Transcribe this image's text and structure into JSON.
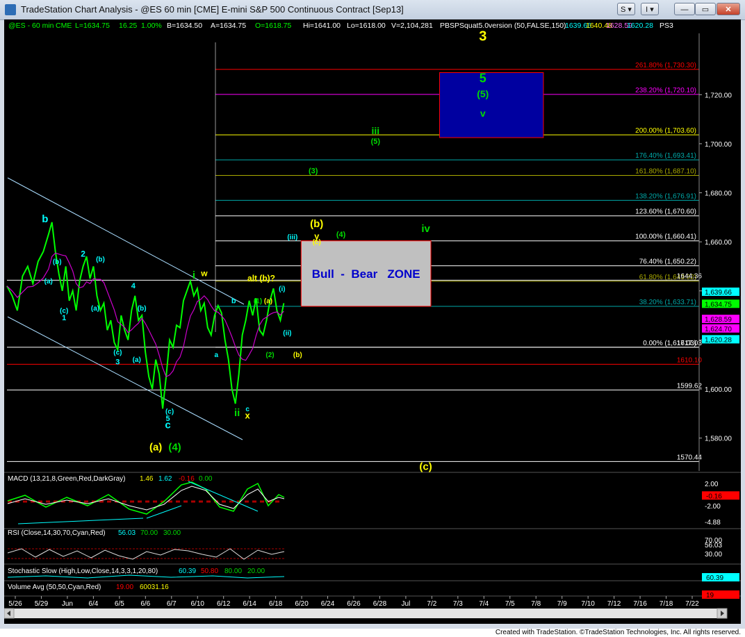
{
  "window": {
    "title": "TradeStation Chart Analysis - @ES 60 min [CME] E-mini S&P 500 Continuous Contract [Sep13]",
    "buttons": {
      "s": "S",
      "i": "I",
      "minimize": "—",
      "maximize": "▭",
      "close": "✕"
    }
  },
  "header": {
    "symbol": "@ES - 60 min",
    "exchange": "CME",
    "last": "L=1634.75",
    "change": "16.25",
    "pct": "1.00%",
    "bid": "B=1634.50",
    "ask": "A=1634.75",
    "open": "O=1618.75",
    "high": "Hi=1641.00",
    "low": "Lo=1618.00",
    "volume": "V=2,104,281",
    "indicator": "PBSPSquat5.0version (50,FALSE,150)",
    "ind_values": [
      "1639.66",
      "1640.48",
      "1628.59",
      "1620.28"
    ],
    "ind_tail": "PS3"
  },
  "colors": {
    "bg": "#000000",
    "price": "#00ff00",
    "cyan": "#00ffff",
    "yellow": "#ffff00",
    "green": "#00dd00",
    "red": "#ff0000",
    "magenta": "#dd00dd",
    "white": "#ffffff",
    "zone_bull": "#c0c0c0",
    "zone_top": "#0000a0"
  },
  "chart_data": {
    "type": "line",
    "title": "@ES 60 min [CME] E-mini S&P 500 Continuous Contract [Sep13]",
    "ylim": [
      1568,
      1745
    ],
    "y_ticks": [
      1580,
      1600,
      1620,
      1640,
      1660,
      1680,
      1700,
      1720
    ],
    "x_ticks": [
      "5/26",
      "5/29",
      "Jun",
      "6/4",
      "6/5",
      "6/6",
      "6/7",
      "6/10",
      "6/12",
      "6/14",
      "6/18",
      "6/20",
      "6/24",
      "6/26",
      "6/28",
      "Jul",
      "7/2",
      "7/3",
      "7/4",
      "7/5",
      "7/8",
      "7/9",
      "7/10",
      "7/12",
      "7/16",
      "7/18",
      "7/22"
    ],
    "price_series": [
      [
        0,
        1642
      ],
      [
        0.3,
        1638
      ],
      [
        0.6,
        1632
      ],
      [
        0.9,
        1646
      ],
      [
        1.2,
        1650
      ],
      [
        1.5,
        1643
      ],
      [
        1.8,
        1652
      ],
      [
        2.1,
        1656
      ],
      [
        2.4,
        1663
      ],
      [
        2.6,
        1668
      ],
      [
        2.8,
        1656
      ],
      [
        3.0,
        1647
      ],
      [
        3.2,
        1640
      ],
      [
        3.4,
        1650
      ],
      [
        3.6,
        1636
      ],
      [
        3.8,
        1640
      ],
      [
        4.0,
        1632
      ],
      [
        4.2,
        1644
      ],
      [
        4.4,
        1650
      ],
      [
        4.6,
        1654
      ],
      [
        4.8,
        1645
      ],
      [
        5.0,
        1650
      ],
      [
        5.2,
        1638
      ],
      [
        5.4,
        1632
      ],
      [
        5.6,
        1635
      ],
      [
        5.8,
        1624
      ],
      [
        6.0,
        1628
      ],
      [
        6.2,
        1619
      ],
      [
        6.4,
        1616
      ],
      [
        6.6,
        1630
      ],
      [
        6.8,
        1624
      ],
      [
        7.0,
        1620
      ],
      [
        7.2,
        1632
      ],
      [
        7.4,
        1638
      ],
      [
        7.6,
        1628
      ],
      [
        7.8,
        1630
      ],
      [
        8.0,
        1615
      ],
      [
        8.2,
        1605
      ],
      [
        8.4,
        1600
      ],
      [
        8.6,
        1612
      ],
      [
        8.8,
        1606
      ],
      [
        9.0,
        1592
      ],
      [
        9.2,
        1605
      ],
      [
        9.4,
        1620
      ],
      [
        9.6,
        1617
      ],
      [
        9.8,
        1626
      ],
      [
        10.0,
        1625
      ],
      [
        10.2,
        1636
      ],
      [
        10.4,
        1640
      ],
      [
        10.6,
        1644
      ],
      [
        10.8,
        1638
      ],
      [
        11.0,
        1641
      ],
      [
        11.2,
        1632
      ],
      [
        11.4,
        1635
      ],
      [
        11.6,
        1625
      ],
      [
        11.8,
        1622
      ],
      [
        12.0,
        1630
      ],
      [
        12.2,
        1634
      ],
      [
        12.4,
        1631
      ],
      [
        12.6,
        1620
      ],
      [
        12.8,
        1612
      ],
      [
        13.0,
        1600
      ],
      [
        13.2,
        1594
      ],
      [
        13.4,
        1606
      ],
      [
        13.6,
        1622
      ],
      [
        13.8,
        1628
      ],
      [
        14.0,
        1636
      ],
      [
        14.2,
        1630
      ],
      [
        14.4,
        1637
      ],
      [
        14.6,
        1624
      ],
      [
        14.8,
        1622
      ],
      [
        15.0,
        1628
      ],
      [
        15.2,
        1636
      ],
      [
        15.4,
        1641
      ],
      [
        15.6,
        1632
      ],
      [
        15.8,
        1628
      ],
      [
        16.0,
        1635
      ]
    ],
    "fib_levels": [
      {
        "pct": "261.80%",
        "value": 1730.3,
        "label": "261.80% (1,730.30)",
        "color": "#ff0000"
      },
      {
        "pct": "238.20%",
        "value": 1720.1,
        "label": "238.20% (1,720.10)",
        "color": "#ff00ff"
      },
      {
        "pct": "200.00%",
        "value": 1703.6,
        "label": "200.00% (1,703.60)",
        "color": "#ffff00"
      },
      {
        "pct": "176.40%",
        "value": 1693.41,
        "label": "176.40% (1,693.41)",
        "color": "#00aaaa"
      },
      {
        "pct": "161.80%",
        "value": 1687.1,
        "label": "161.80% (1,687.10)",
        "color": "#aaaa00"
      },
      {
        "pct": "138.20%",
        "value": 1676.91,
        "label": "138.20% (1,676.91)",
        "color": "#00aaaa"
      },
      {
        "pct": "123.60%",
        "value": 1670.6,
        "label": "123.60% (1,670.60)",
        "color": "#ffffff"
      },
      {
        "pct": "100.00%",
        "value": 1660.41,
        "label": "100.00% (1,660.41)",
        "color": "#ffffff"
      },
      {
        "pct": "76.40%",
        "value": 1650.22,
        "label": "76.40% (1,650.22)",
        "color": "#ffffff"
      },
      {
        "pct": "61.80%",
        "value": 1643.92,
        "label": "61.80% (1,643.92)",
        "color": "#aaaa00"
      },
      {
        "pct": "38.20%",
        "value": 1633.71,
        "label": "38.20% (1,633.71)",
        "color": "#00aaaa"
      },
      {
        "pct": "0.00%",
        "value": 1617.03,
        "label": "0.00% (1,617.03)",
        "color": "#ffffff"
      }
    ],
    "levels": [
      {
        "value": 1644.36,
        "label": "1644.36",
        "color": "#ffffff"
      },
      {
        "value": 1617.03,
        "label": "1617.03",
        "color": "#ffffff"
      },
      {
        "value": 1610.1,
        "label": "1610.10",
        "color": "#ff0000"
      },
      {
        "value": 1599.62,
        "label": "1599.62",
        "color": "#ffffff"
      },
      {
        "value": 1570.44,
        "label": "1570.44",
        "color": "#ffffff"
      }
    ],
    "axis_badges": [
      {
        "value": 1639.66,
        "label": "1,639.66",
        "color": "#00ffff"
      },
      {
        "value": 1634.75,
        "label": "1,634.75",
        "color": "#00ff00"
      },
      {
        "value": 1628.59,
        "label": "1,628.59",
        "color": "#ff00ff"
      },
      {
        "value": 1624.7,
        "label": "1,624.70",
        "color": "#ff00ff"
      },
      {
        "value": 1620.28,
        "label": "1,620.28",
        "color": "#00ffff"
      }
    ],
    "zones": [
      {
        "name": "Bull - Bear ZONE",
        "label": "Bull  -  Bear   ZONE",
        "top": 1660.41,
        "bottom": 1633.71,
        "x_start": 17.0,
        "x_end": 24.5,
        "fill": "#c0c0c0",
        "text_color": "#0000cc"
      },
      {
        "name": "target box",
        "label": "",
        "top": 1729.0,
        "bottom": 1702.5,
        "x_start": 25.0,
        "x_end": 31.0,
        "fill": "#0000a0",
        "text_color": ""
      }
    ],
    "wave_labels": [
      {
        "text": "3",
        "x": 27.5,
        "y": 1742,
        "color": "#ffff00",
        "size": 20
      },
      {
        "text": "5",
        "x": 27.5,
        "y": 1725,
        "color": "#00dd00",
        "size": 18
      },
      {
        "text": "(5)",
        "x": 27.5,
        "y": 1719,
        "color": "#00dd00",
        "size": 14
      },
      {
        "text": "v",
        "x": 27.5,
        "y": 1711,
        "color": "#00dd00",
        "size": 14
      },
      {
        "text": "iii",
        "x": 21.3,
        "y": 1704,
        "color": "#00dd00",
        "size": 14
      },
      {
        "text": "(5)",
        "x": 21.3,
        "y": 1700,
        "color": "#00dd00",
        "size": 11
      },
      {
        "text": "(3)",
        "x": 17.7,
        "y": 1688,
        "color": "#00dd00",
        "size": 11
      },
      {
        "text": "(b)",
        "x": 17.9,
        "y": 1666,
        "color": "#ffff00",
        "size": 15
      },
      {
        "text": "y",
        "x": 17.9,
        "y": 1661,
        "color": "#ffff00",
        "size": 13
      },
      {
        "text": "(c)",
        "x": 17.9,
        "y": 1659,
        "color": "#ffff00",
        "size": 10
      },
      {
        "text": "(4)",
        "x": 19.3,
        "y": 1662,
        "color": "#00dd00",
        "size": 11
      },
      {
        "text": "iv",
        "x": 24.2,
        "y": 1664,
        "color": "#00dd00",
        "size": 15
      },
      {
        "text": "(iii)",
        "x": 16.5,
        "y": 1661,
        "color": "#00ffff",
        "size": 10
      },
      {
        "text": "alt (b)?",
        "x": 14.7,
        "y": 1644,
        "color": "#ffff00",
        "size": 12
      },
      {
        "text": "(i)",
        "x": 15.9,
        "y": 1640,
        "color": "#00ffff",
        "size": 10
      },
      {
        "text": "(1)",
        "x": 14.5,
        "y": 1635,
        "color": "#00dd00",
        "size": 10
      },
      {
        "text": "(a)",
        "x": 15.1,
        "y": 1635,
        "color": "#ffff00",
        "size": 10
      },
      {
        "text": "(ii)",
        "x": 16.2,
        "y": 1622,
        "color": "#00ffff",
        "size": 10
      },
      {
        "text": "(2)",
        "x": 15.2,
        "y": 1613,
        "color": "#00dd00",
        "size": 10
      },
      {
        "text": "(b)",
        "x": 16.8,
        "y": 1613,
        "color": "#ffff00",
        "size": 10
      },
      {
        "text": "b",
        "x": 2.2,
        "y": 1668,
        "color": "#00ffff",
        "size": 15
      },
      {
        "text": "(b)",
        "x": 2.9,
        "y": 1651,
        "color": "#00ffff",
        "size": 10
      },
      {
        "text": "(a)",
        "x": 2.4,
        "y": 1643,
        "color": "#00ffff",
        "size": 10
      },
      {
        "text": "2",
        "x": 4.4,
        "y": 1654,
        "color": "#00ffff",
        "size": 12
      },
      {
        "text": "(b)",
        "x": 5.4,
        "y": 1652,
        "color": "#00ffff",
        "size": 10
      },
      {
        "text": "(c)",
        "x": 3.3,
        "y": 1631,
        "color": "#00ffff",
        "size": 10
      },
      {
        "text": "1",
        "x": 3.3,
        "y": 1628,
        "color": "#00ffff",
        "size": 11
      },
      {
        "text": "4",
        "x": 7.3,
        "y": 1641,
        "color": "#00ffff",
        "size": 11
      },
      {
        "text": "(a)",
        "x": 5.1,
        "y": 1632,
        "color": "#00ffff",
        "size": 10
      },
      {
        "text": "(b)",
        "x": 7.8,
        "y": 1632,
        "color": "#00ffff",
        "size": 10
      },
      {
        "text": "(c)",
        "x": 6.4,
        "y": 1614,
        "color": "#00ffff",
        "size": 10
      },
      {
        "text": "3",
        "x": 6.4,
        "y": 1610,
        "color": "#00ffff",
        "size": 11
      },
      {
        "text": "(a)",
        "x": 7.5,
        "y": 1611,
        "color": "#00ffff",
        "size": 10
      },
      {
        "text": "i",
        "x": 10.8,
        "y": 1645,
        "color": "#00dd00",
        "size": 15
      },
      {
        "text": "w",
        "x": 11.4,
        "y": 1646,
        "color": "#ffff00",
        "size": 12
      },
      {
        "text": "b",
        "x": 13.1,
        "y": 1635,
        "color": "#00ffff",
        "size": 11
      },
      {
        "text": "a",
        "x": 12.1,
        "y": 1613,
        "color": "#00ffff",
        "size": 10
      },
      {
        "text": "ii",
        "x": 13.3,
        "y": 1589,
        "color": "#00dd00",
        "size": 15
      },
      {
        "text": "c",
        "x": 13.9,
        "y": 1591,
        "color": "#00ffff",
        "size": 10
      },
      {
        "text": "x",
        "x": 13.9,
        "y": 1588,
        "color": "#ffff00",
        "size": 13
      },
      {
        "text": "(c)",
        "x": 9.4,
        "y": 1590,
        "color": "#00ffff",
        "size": 10
      },
      {
        "text": "5",
        "x": 9.3,
        "y": 1587,
        "color": "#00ffff",
        "size": 11
      },
      {
        "text": "c",
        "x": 9.3,
        "y": 1584,
        "color": "#00ffff",
        "size": 15
      },
      {
        "text": "(a)",
        "x": 8.6,
        "y": 1575,
        "color": "#ffff00",
        "size": 15
      },
      {
        "text": "(4)",
        "x": 9.7,
        "y": 1575,
        "color": "#00dd00",
        "size": 15
      },
      {
        "text": "(c)",
        "x": 24.2,
        "y": 1567,
        "color": "#ffff00",
        "size": 15
      }
    ],
    "x_domain": [
      0,
      40
    ]
  },
  "macd": {
    "label": "MACD (13,21,8,Green,Red,DarkGray)",
    "v1": "1.46",
    "v2": "1.62",
    "v3": "-0.16",
    "v4": "0.00",
    "ylim": [
      -6,
      4
    ],
    "ticks": [
      {
        "value": 2.0,
        "label": "2.00"
      },
      {
        "value": -2.0,
        "label": "-2.00"
      },
      {
        "value": -4.88,
        "label": "-4.88"
      }
    ],
    "badge": {
      "value": -0.16,
      "label": "-0.16"
    }
  },
  "rsi": {
    "label": "RSI (Close,14,30,70,Cyan,Red)",
    "v1": "56.03",
    "v2": "70.00",
    "v3": "30.00",
    "ticks": [
      {
        "value": 70,
        "label": "70.00"
      },
      {
        "value": 56.03,
        "label": "56.03"
      },
      {
        "value": 30,
        "label": "30.00"
      }
    ]
  },
  "stoch": {
    "label": "Stochastic Slow (High,Low,Close,14,3,3,1,20,80)",
    "v1": "60.39",
    "v2": "50.80",
    "v3": "80.00",
    "v4": "20.00",
    "badge": "60.39"
  },
  "volume": {
    "label": "Volume Avg (50,50,Cyan,Red)",
    "v1": "19.00",
    "v2": "60031.16",
    "badge": "19"
  },
  "footer": {
    "credit": "Created with TradeStation. ©TradeStation Technologies, Inc. All rights reserved."
  }
}
